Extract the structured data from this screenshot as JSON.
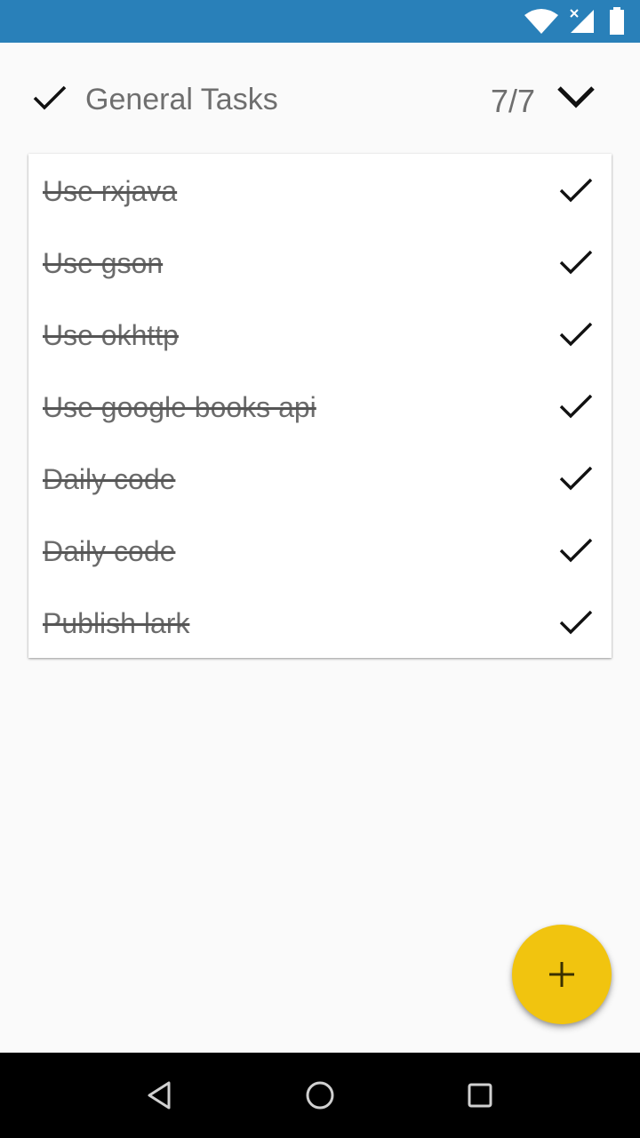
{
  "status_bar": {
    "color": "#2980b9",
    "icons": [
      "wifi-icon",
      "signal-icon",
      "battery-icon"
    ]
  },
  "header": {
    "title": "General Tasks",
    "count": "7/7",
    "icons": [
      "check-icon",
      "chevron-down-icon"
    ]
  },
  "tasks": [
    {
      "label": "Use rxjava",
      "done": true
    },
    {
      "label": "Use gson",
      "done": true
    },
    {
      "label": "Use okhttp",
      "done": true
    },
    {
      "label": "Use google books api",
      "done": true
    },
    {
      "label": "Daily code",
      "done": true
    },
    {
      "label": "Daily code",
      "done": true
    },
    {
      "label": "Publish lark",
      "done": true
    }
  ],
  "fab": {
    "icon": "plus-icon",
    "color": "#f1c40f"
  },
  "nav_bar": {
    "icons": [
      "back-icon",
      "home-icon",
      "recents-icon"
    ]
  }
}
